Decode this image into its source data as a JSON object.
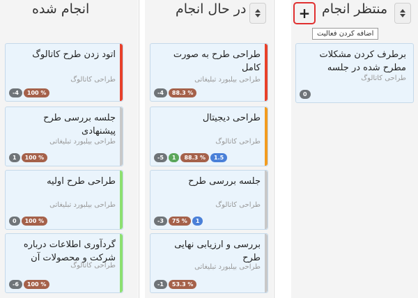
{
  "columns": [
    {
      "title": "انجام شده",
      "cards": [
        {
          "title": "اتود زدن طرح کاتالوگ",
          "project": "طراحی کاتالوگ",
          "stripe": "#e8412a",
          "badges": [
            {
              "text": "-4",
              "kind": "gray"
            },
            {
              "text": "100 %",
              "kind": "brown"
            }
          ]
        },
        {
          "title": "جلسه بررسی طرح پیشنهادی",
          "project": "طراحی بیلبورد تبلیغاتی",
          "stripe": "#c8c8c8",
          "badges": [
            {
              "text": "1",
              "kind": "gray"
            },
            {
              "text": "100 %",
              "kind": "brown"
            }
          ]
        },
        {
          "title": "طراحی طرح اولیه",
          "project": "طراحی بیلبورد تبلیغاتی",
          "stripe": "#8ee070",
          "badges": [
            {
              "text": "0",
              "kind": "gray"
            },
            {
              "text": "100 %",
              "kind": "brown"
            }
          ]
        },
        {
          "title": "گردآوری اطلاعات درباره شرکت و محصولات آن",
          "project": "طراحی کاتالوگ",
          "stripe": "#8ee070",
          "badges": [
            {
              "text": "-6",
              "kind": "gray"
            },
            {
              "text": "100 %",
              "kind": "brown"
            }
          ]
        }
      ]
    },
    {
      "title": "در حال انجام",
      "cards": [
        {
          "title": "طراحی طرح به صورت کامل",
          "project": "طراحی بیلبورد تبلیغاتی",
          "stripe": "#e8412a",
          "badges": [
            {
              "text": "-4",
              "kind": "gray"
            },
            {
              "text": "88.3 %",
              "kind": "brown"
            }
          ]
        },
        {
          "title": "طراحی دیجیتال",
          "project": "طراحی کاتالوگ",
          "stripe": "#f39c1f",
          "badges": [
            {
              "text": "-5",
              "kind": "gray"
            },
            {
              "text": "1",
              "kind": "green"
            },
            {
              "text": "88.3 %",
              "kind": "brown"
            },
            {
              "text": "1.5",
              "kind": "blue"
            }
          ]
        },
        {
          "title": "جلسه بررسی طرح",
          "project": "طراحی کاتالوگ",
          "stripe": "#c8c8c8",
          "badges": [
            {
              "text": "-3",
              "kind": "gray"
            },
            {
              "text": "75 %",
              "kind": "brown"
            },
            {
              "text": "1",
              "kind": "blue"
            }
          ]
        },
        {
          "title": "بررسی و ارزیابی نهایی طرح",
          "project": "طراحی بیلبورد تبلیغاتی",
          "stripe": "#c8c8c8",
          "badges": [
            {
              "text": "-1",
              "kind": "gray"
            },
            {
              "text": "53.3 %",
              "kind": "brown"
            }
          ]
        }
      ]
    },
    {
      "title": "منتظر انجام",
      "add_button": "+",
      "tooltip": "اضافه کردن فعالیت",
      "cards": [
        {
          "title": "برطرف کردن مشکلات مطرح شده در جلسه",
          "project": "طراحی کاتالوگ",
          "stripe": "",
          "badges": [
            {
              "text": "0",
              "kind": "gray"
            }
          ]
        }
      ]
    }
  ]
}
